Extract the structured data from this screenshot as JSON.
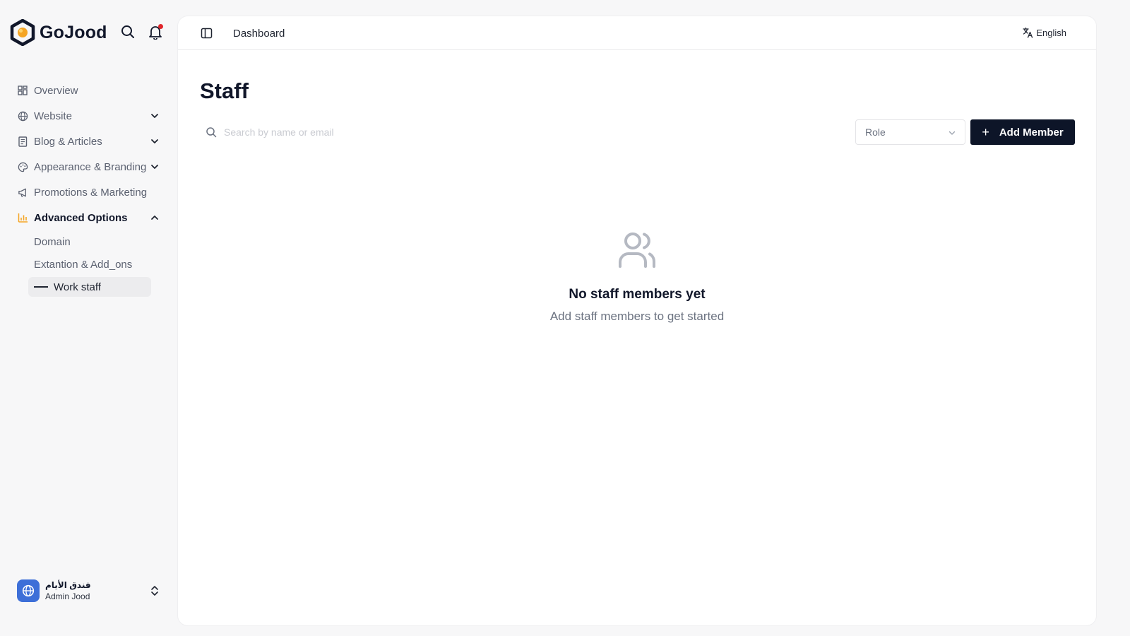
{
  "brand": {
    "name": "GoJood",
    "accent": "#f5a524",
    "dark": "#11172a"
  },
  "header_icons": {
    "search": "search-icon",
    "notifications": "bell-icon",
    "notification_dot_color": "#e0262b"
  },
  "sidebar": {
    "items": [
      {
        "label": "Overview",
        "icon": "grid-icon",
        "expandable": false
      },
      {
        "label": "Website",
        "icon": "globe-icon",
        "expandable": true
      },
      {
        "label": "Blog & Articles",
        "icon": "newspaper-icon",
        "expandable": true
      },
      {
        "label": "Appearance & Branding",
        "icon": "palette-icon",
        "expandable": true
      },
      {
        "label": "Promotions & Marketing",
        "icon": "megaphone-icon",
        "expandable": false
      },
      {
        "label": "Advanced Options",
        "icon": "bar-chart-icon",
        "expandable": true,
        "expanded": true
      }
    ],
    "subitems": [
      {
        "label": "Domain"
      },
      {
        "label": "Extantion & Add_ons"
      },
      {
        "label": "Work staff",
        "current": true
      }
    ]
  },
  "account": {
    "name": "فندق الأيام",
    "role": "Admin Jood",
    "avatar_color": "#3d6fd8"
  },
  "topbar": {
    "breadcrumb": "Dashboard",
    "language": "English"
  },
  "page": {
    "title": "Staff",
    "search": {
      "placeholder": "Search by name or email",
      "value": ""
    },
    "role_filter": {
      "label": "Role"
    },
    "add_button": {
      "label": "Add Member",
      "color": "#0d1528"
    },
    "empty_state": {
      "title": "No staff members yet",
      "subtitle": "Add staff members to get started"
    }
  }
}
